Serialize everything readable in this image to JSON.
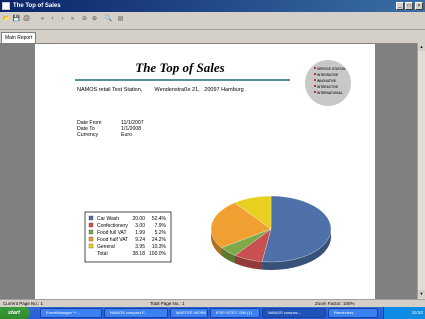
{
  "window": {
    "title": "The Top of Sales",
    "controls": [
      "_",
      "□",
      "×"
    ]
  },
  "toolbar": {
    "buttons": [
      {
        "name": "open-icon",
        "glyph": "📂"
      },
      {
        "name": "save-icon",
        "glyph": "💾"
      },
      {
        "name": "print-setup-icon",
        "glyph": "🖨"
      },
      {
        "name": "first-page-icon",
        "glyph": "«"
      },
      {
        "name": "prev-page-icon",
        "glyph": "‹"
      },
      {
        "name": "next-page-icon",
        "glyph": "›"
      },
      {
        "name": "last-page-icon",
        "glyph": "»"
      },
      {
        "name": "zoom-out-icon",
        "glyph": "⊖"
      },
      {
        "name": "zoom-in-icon",
        "glyph": "⊕"
      },
      {
        "name": "find-icon",
        "glyph": "🔍"
      },
      {
        "name": "export-icon",
        "glyph": "▤"
      }
    ]
  },
  "tabs": [
    "Main Report"
  ],
  "report": {
    "title": "The Top of Sales",
    "address": "NAMOS retail Test Station,        Wendenstraße 21,   20097 Hamburg",
    "logo_lines": [
      "SERVICE STATION",
      "INTEGRATIVE",
      "INNOVATIVE",
      "INTERACTIVE",
      "INTERNATIONAL"
    ],
    "fields": [
      {
        "label": "Date From",
        "value": "11/1/2007"
      },
      {
        "label": "Date To",
        "value": "1/1/2008"
      },
      {
        "label": "Currency",
        "value": "Euro"
      }
    ]
  },
  "chart_data": {
    "type": "pie",
    "categories": [
      "Car Wash",
      "Confectionery",
      "Food full VAT",
      "Food half VAT",
      "General"
    ],
    "values": [
      20.0,
      3.0,
      1.99,
      9.24,
      3.95
    ],
    "value_labels": [
      "20.00",
      "3.00",
      "1.99",
      "9.24",
      "3.95"
    ],
    "percent_labels": [
      "52.4%",
      "7.9%",
      "5.2%",
      "24.2%",
      "10.3%"
    ],
    "colors": [
      "#4d71a8",
      "#c85050",
      "#7fa84a",
      "#f0a030",
      "#e8d020"
    ],
    "total": {
      "label": "Total",
      "value": "38.18",
      "percent": "100.0%"
    }
  },
  "status": {
    "current_page": "Current Page No.: 1",
    "total_page": "Total Page No.: 1",
    "zoom": "Zoom Factor: 100%"
  },
  "taskbar": {
    "start": "start",
    "items": [
      {
        "label": "EventManager **...",
        "active": false
      },
      {
        "label": "NAMOS compact F...",
        "active": false
      },
      {
        "label": "MASTER WORK",
        "active": false
      },
      {
        "label": "IFSP ISTEC SIM (1)",
        "active": false
      },
      {
        "label": "NAMOS compac...",
        "active": true
      },
      {
        "label": "Reminders",
        "active": false
      }
    ],
    "clock": "15:52"
  }
}
